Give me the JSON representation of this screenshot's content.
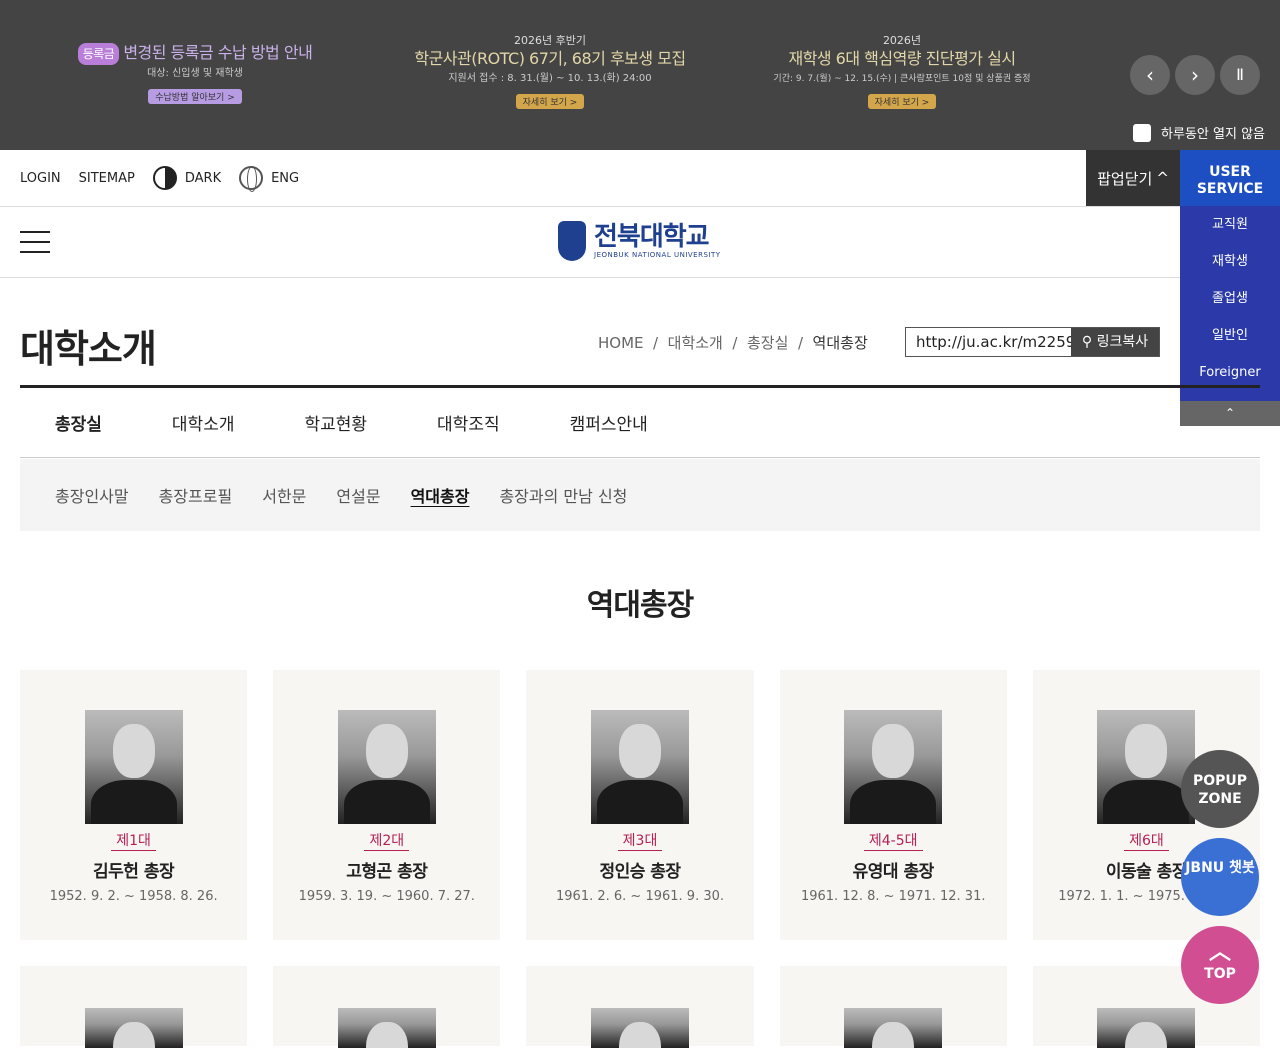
{
  "popup_slides": [
    {
      "tag": "등록금",
      "title": "변경된 등록금 수납 방법 안내",
      "sub": "대상: 신입생 및 재학생",
      "btn": "수납방법 알아보기 >"
    },
    {
      "small": "2026년 후반기",
      "title": "학군사관(ROTC) 67기, 68기 후보생 모집",
      "sub": "지원서 접수 : 8. 31.(월) ~ 10. 13.(화) 24:00",
      "btn": "자세히 보기 >"
    },
    {
      "small": "2026년",
      "title": "재학생 6대 핵심역량 진단평가 실시",
      "sub": "기간: 9. 7.(월) ~ 12. 15.(수) | 큰사람포인트 10점 및 상품권 증정",
      "btn": "자세히 보기 >"
    }
  ],
  "popup_controls": {
    "prev": "‹",
    "next": "›",
    "pause": "Ⅱ"
  },
  "no_show_today": "하루동안 열지 않음",
  "util": {
    "login": "LOGIN",
    "sitemap": "SITEMAP",
    "dark": "DARK",
    "eng": "ENG",
    "popup_close": "팝업닫기"
  },
  "logo": {
    "ko": "전북대학교",
    "en": "JEONBUK NATIONAL UNIVERSITY"
  },
  "user_service": {
    "title": "USER SERVICE",
    "items": [
      "교직원",
      "재학생",
      "졸업생",
      "일반인",
      "Foreigner"
    ],
    "up": "⌃"
  },
  "page_title": "대학소개",
  "breadcrumb": [
    "HOME",
    "대학소개",
    "총장실",
    "역대총장"
  ],
  "link": {
    "url": "http://ju.ac.kr/m2259",
    "copy": "링크복사"
  },
  "tabs1": [
    "총장실",
    "대학소개",
    "학교현황",
    "대학조직",
    "캠퍼스안내"
  ],
  "tabs2": [
    "총장인사말",
    "총장프로필",
    "서한문",
    "연설문",
    "역대총장",
    "총장과의 만남 신청"
  ],
  "section_title": "역대총장",
  "presidents": [
    {
      "gen": "제1대",
      "name": "김두헌  총장",
      "term": "1952. 9. 2. ~ 1958. 8. 26."
    },
    {
      "gen": "제2대",
      "name": "고형곤  총장",
      "term": "1959. 3. 19. ~ 1960. 7. 27."
    },
    {
      "gen": "제3대",
      "name": "정인승  총장",
      "term": "1961. 2. 6. ~ 1961. 9. 30."
    },
    {
      "gen": "제4-5대",
      "name": "유영대  총장",
      "term": "1961. 12. 8. ~ 1971. 12. 31."
    },
    {
      "gen": "제6대",
      "name": "이동술  총장",
      "term": "1972. 1. 1. ~ 1975. 12. 31."
    }
  ],
  "floating": {
    "popup": "POPUP ZONE",
    "chat": "JBNU 챗봇",
    "top": "TOP"
  }
}
